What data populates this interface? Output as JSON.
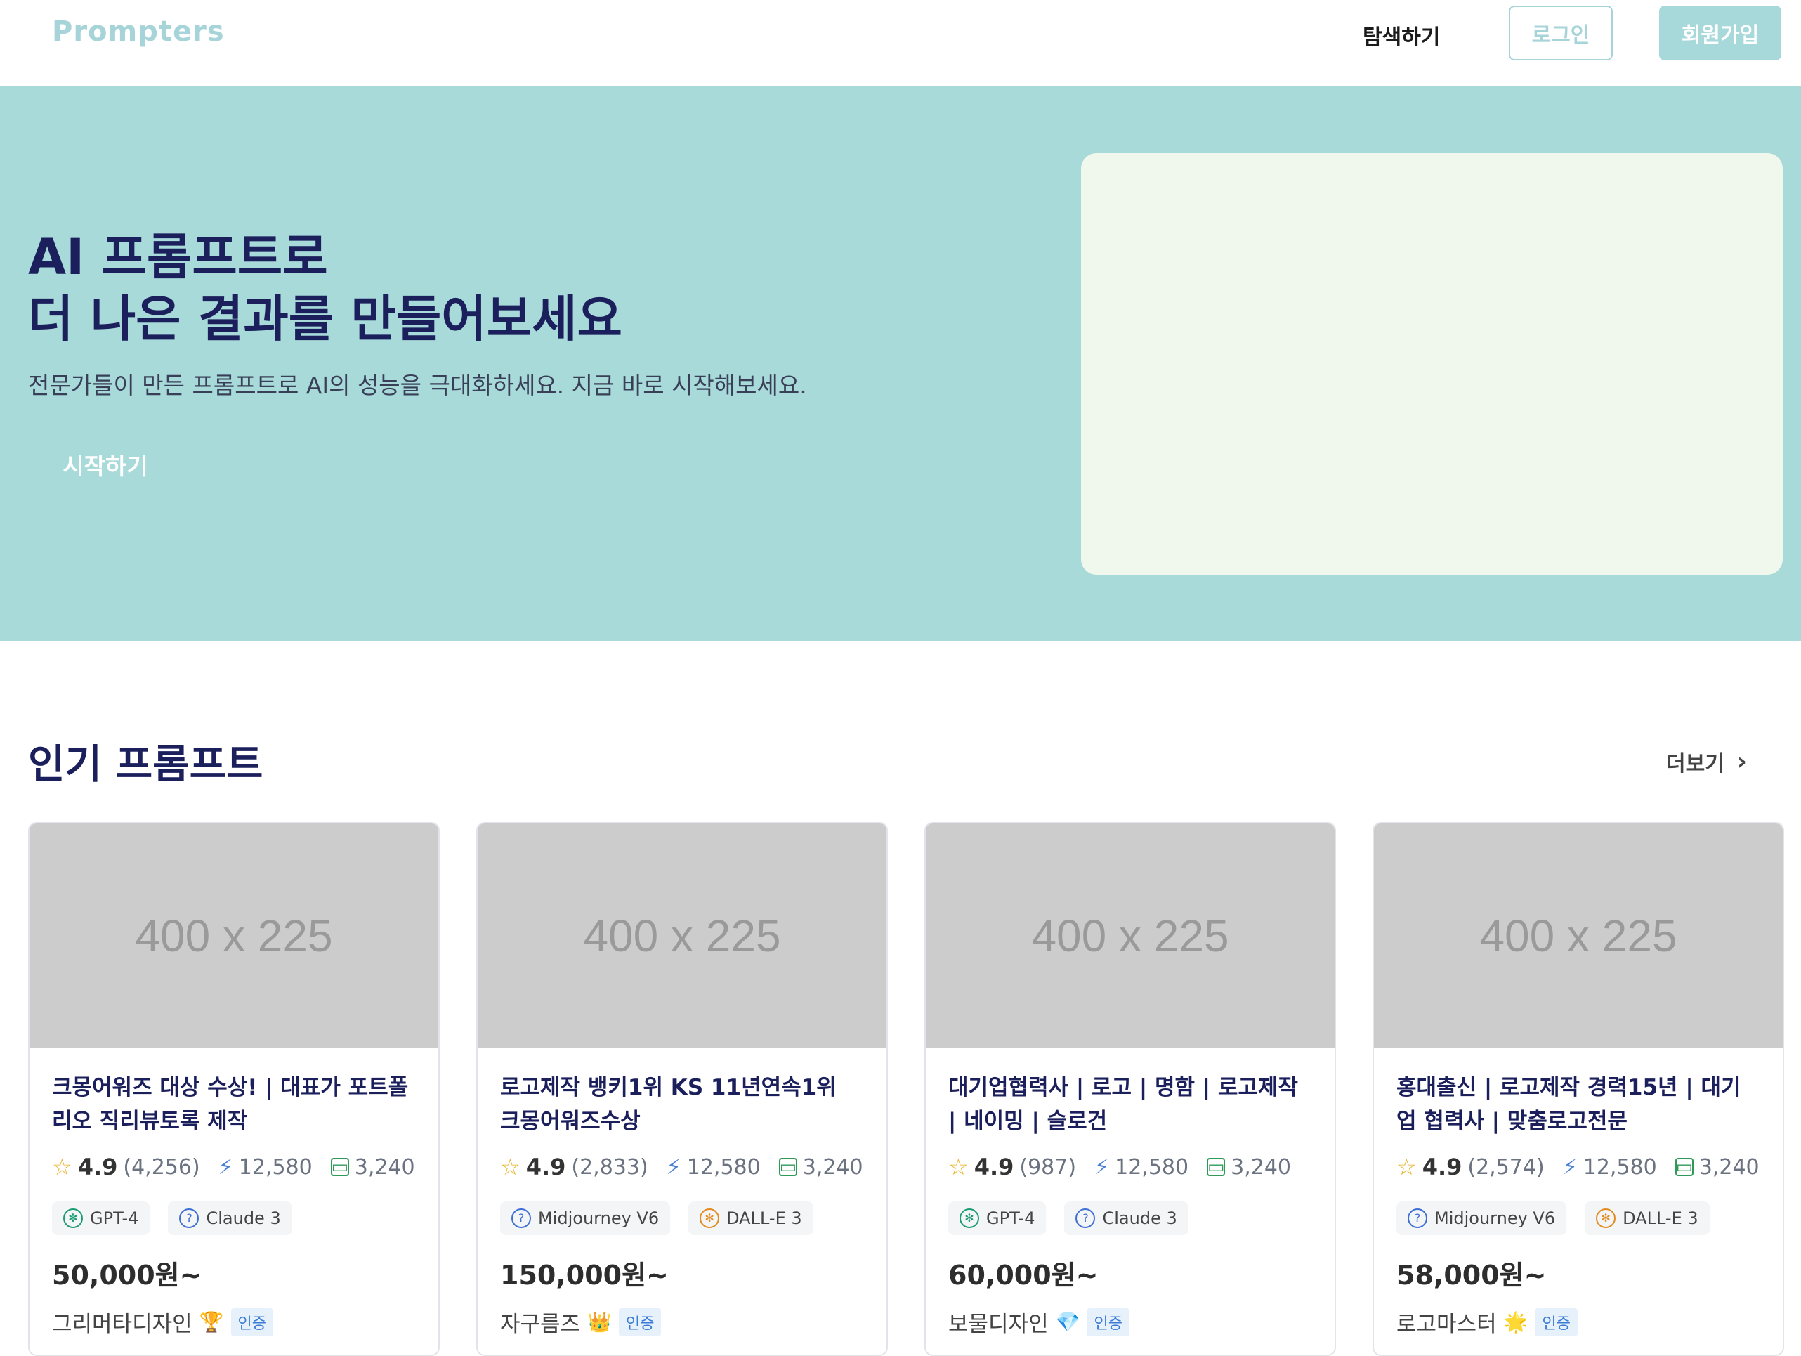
{
  "header": {
    "logo": "Prompters",
    "explore": "탐색하기",
    "login": "로그인",
    "signup": "회원가입"
  },
  "hero": {
    "title_line1": "AI 프롬프트로",
    "title_line2": "더 나은 결과를 만들어보세요",
    "subtitle": "전문가들이 만든 프롬프트로 AI의 성능을 극대화하세요. 지금 바로 시작해보세요.",
    "cta": "시작하기"
  },
  "popular": {
    "title": "인기 프롬프트",
    "more": "더보기",
    "cards": [
      {
        "thumb": "400 x 225",
        "title": "크몽어워즈 대상 수상! | 대표가 포트폴리오 직리뷰토록 제작",
        "rating": "4.9",
        "reviews": "(4,256)",
        "uses": "12,580",
        "sales": "3,240",
        "tags": [
          {
            "icon": "openai-icon",
            "label": "GPT-4"
          },
          {
            "icon": "question-icon",
            "label": "Claude 3"
          }
        ],
        "price": "50,000원~",
        "seller": "그리머타디자인",
        "seller_badge": "🏆",
        "verified": "인증"
      },
      {
        "thumb": "400 x 225",
        "title": "로고제작 뱅키1위 KS 11년연속1위 크몽어워즈수상",
        "rating": "4.9",
        "reviews": "(2,833)",
        "uses": "12,580",
        "sales": "3,240",
        "tags": [
          {
            "icon": "question-icon",
            "label": "Midjourney V6"
          },
          {
            "icon": "openai-icon",
            "label": "DALL-E 3"
          }
        ],
        "price": "150,000원~",
        "seller": "자구름즈",
        "seller_badge": "👑",
        "verified": "인증"
      },
      {
        "thumb": "400 x 225",
        "title": "대기업협력사 | 로고 | 명함 | 로고제작 | 네이밍 | 슬로건",
        "rating": "4.9",
        "reviews": "(987)",
        "uses": "12,580",
        "sales": "3,240",
        "tags": [
          {
            "icon": "openai-icon",
            "label": "GPT-4"
          },
          {
            "icon": "question-icon",
            "label": "Claude 3"
          }
        ],
        "price": "60,000원~",
        "seller": "보물디자인",
        "seller_badge": "💎",
        "verified": "인증"
      },
      {
        "thumb": "400 x 225",
        "title": "홍대출신 | 로고제작 경력15년 | 대기업 협력사 | 맞춤로고전문",
        "rating": "4.9",
        "reviews": "(2,574)",
        "uses": "12,580",
        "sales": "3,240",
        "tags": [
          {
            "icon": "question-icon",
            "label": "Midjourney V6"
          },
          {
            "icon": "openai-icon",
            "label": "DALL-E 3"
          }
        ],
        "price": "58,000원~",
        "seller": "로고마스터",
        "seller_badge": "🌟",
        "verified": "인증"
      }
    ]
  },
  "colors": {
    "brand": "#a7d4d9",
    "hero_bg": "#a8dada",
    "hero_media": "#f0f8ee",
    "heading": "#1b1f5c"
  }
}
